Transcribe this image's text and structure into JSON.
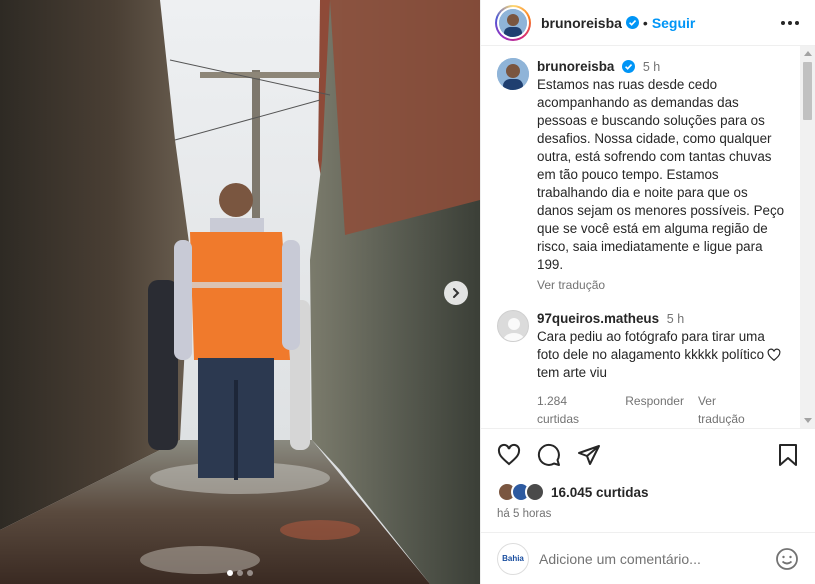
{
  "post": {
    "username": "brunoreisba",
    "follow_label": "Seguir",
    "bullet": "•",
    "caption_time": "5 h",
    "caption": "Estamos nas ruas desde cedo acompanhando as demandas das pessoas e buscando soluções para os desafios. Nossa cidade, como qualquer outra, está sofrendo com tantas chuvas em tão pouco tempo. Estamos trabalhando dia e noite para que os danos sejam os menores possíveis. Peço que se você está em alguma região de risco, saia imediatamente e ligue para 199.",
    "translate_label": "Ver tradução"
  },
  "comment": {
    "username": "97queiros.matheus",
    "time": "5 h",
    "text": "Cara pediu ao fotógrafo para tirar uma foto dele no alagamento kkkkk político tem arte viu",
    "likes": "1.284 curtidas",
    "reply_label": "Responder",
    "translate_label": "Ver tradução"
  },
  "footer": {
    "likes_count": "16.045 curtidas",
    "time_ago": "há 5 horas",
    "comment_placeholder": "Adicione um comentário...",
    "my_avatar_text": "Bahia"
  },
  "carousel": {
    "total": 3,
    "current": 1
  },
  "icons": [
    "more-icon",
    "heart-icon",
    "comment-icon",
    "share-icon",
    "save-icon",
    "emoji-icon",
    "chevron-right-icon",
    "verified-icon"
  ],
  "colors": {
    "accent": "#0095f6",
    "vest": "#f07a2c",
    "muted": "#737373"
  }
}
